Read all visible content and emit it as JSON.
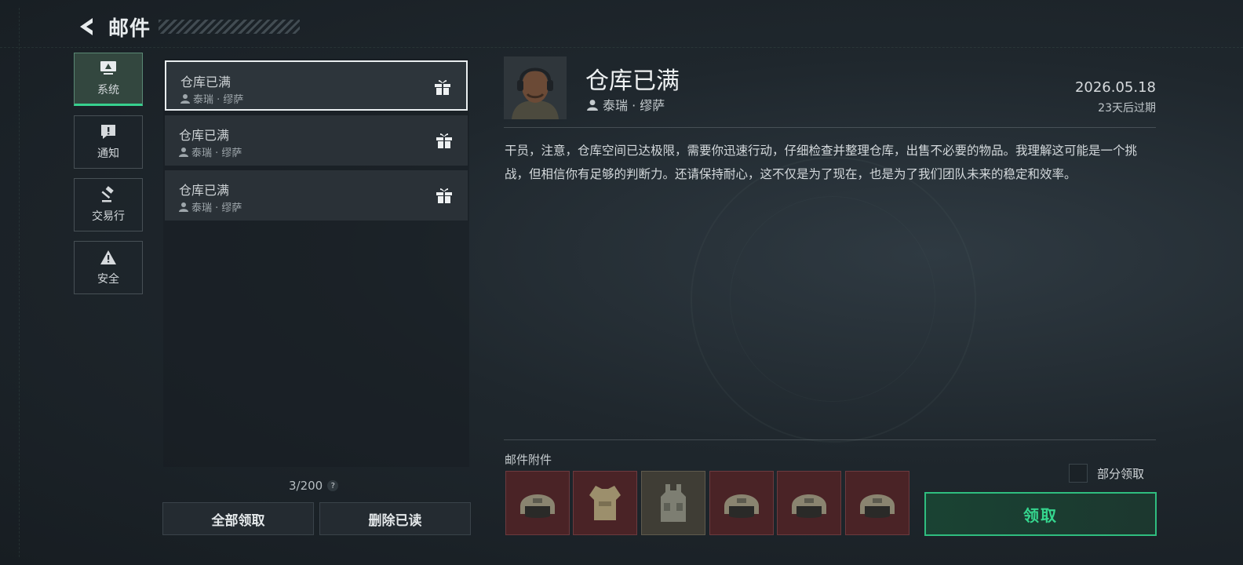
{
  "header": {
    "title": "邮件"
  },
  "nav": {
    "items": [
      {
        "label": "系统",
        "icon": "monitor-icon",
        "active": true
      },
      {
        "label": "通知",
        "icon": "exclamation-icon",
        "active": false
      },
      {
        "label": "交易行",
        "icon": "gavel-icon",
        "active": false
      },
      {
        "label": "安全",
        "icon": "warning-icon",
        "active": false
      }
    ]
  },
  "mails": [
    {
      "title": "仓库已满",
      "from": "泰瑞 · 缪萨",
      "icon": "gift-icon",
      "selected": true
    },
    {
      "title": "仓库已满",
      "from": "泰瑞 · 缪萨",
      "icon": "gift-icon",
      "selected": false
    },
    {
      "title": "仓库已满",
      "from": "泰瑞 · 缪萨",
      "icon": "gift-icon",
      "selected": false
    }
  ],
  "list_footer": {
    "count": "3/200",
    "help": "?",
    "claim_all": "全部领取",
    "delete_read": "删除已读"
  },
  "detail": {
    "title": "仓库已满",
    "from": "泰瑞 · 缪萨",
    "date": "2026.05.18",
    "expire": "23天后过期",
    "body": "干员，注意，仓库空间已达极限，需要你迅速行动，仔细检查并整理仓库，出售不必要的物品。我理解这可能是一个挑战，但相信你有足够的判断力。还请保持耐心，这不仅是为了现在，也是为了我们团队未来的稳定和效率。",
    "attach_label": "邮件附件",
    "attachments": [
      "helmet-icon",
      "body-armor-icon",
      "tactical-vest-icon",
      "helmet-icon",
      "helmet-icon",
      "helmet-icon"
    ],
    "partial_label": "部分领取",
    "claim_label": "领取"
  },
  "colors": {
    "accent": "#35d68e",
    "selected_border": "#e9eef0",
    "attach_bg": "#4a2326"
  }
}
